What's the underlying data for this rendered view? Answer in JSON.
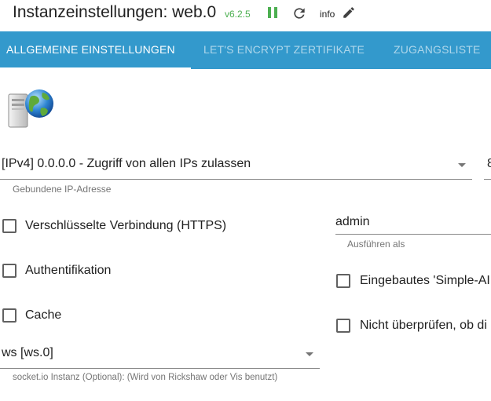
{
  "header": {
    "title": "Instanzeinstellungen: web.0",
    "version": "v6.2.5",
    "info_label": "info",
    "icons": [
      "pause-icon",
      "reload-icon",
      "edit-icon"
    ],
    "colors": {
      "version": "#4caf50",
      "pause": "#4caf50"
    }
  },
  "tabs": [
    {
      "label": "ALLGEMEINE EINSTELLUNGEN",
      "active": true
    },
    {
      "label": "LET'S ENCRYPT ZERTIFIKATE",
      "active": false
    },
    {
      "label": "ZUGANGSLISTE",
      "active": false
    }
  ],
  "tab_bar_color": "#3399cc",
  "form": {
    "bind": {
      "value": "[IPv4] 0.0.0.0 - Zugriff von allen IPs zulassen",
      "helper": "Gebundene IP-Adresse",
      "port_partial": "8"
    },
    "checkboxes": [
      {
        "label": "Verschlüsselte Verbindung (HTTPS)",
        "checked": false
      },
      {
        "label": "Authentifikation",
        "checked": false
      },
      {
        "label": "Cache",
        "checked": false
      }
    ],
    "run_as": {
      "value": "admin",
      "helper": "Ausführen als"
    },
    "right_checkboxes": [
      {
        "label": "Eingebautes 'Simple-AI",
        "checked": false
      },
      {
        "label": "Nicht überprüfen, ob di",
        "checked": false
      }
    ],
    "socketio": {
      "value": "ws [ws.0]",
      "helper": "socket.io Instanz (Optional): (Wird von Rickshaw oder Vis benutzt)"
    }
  }
}
